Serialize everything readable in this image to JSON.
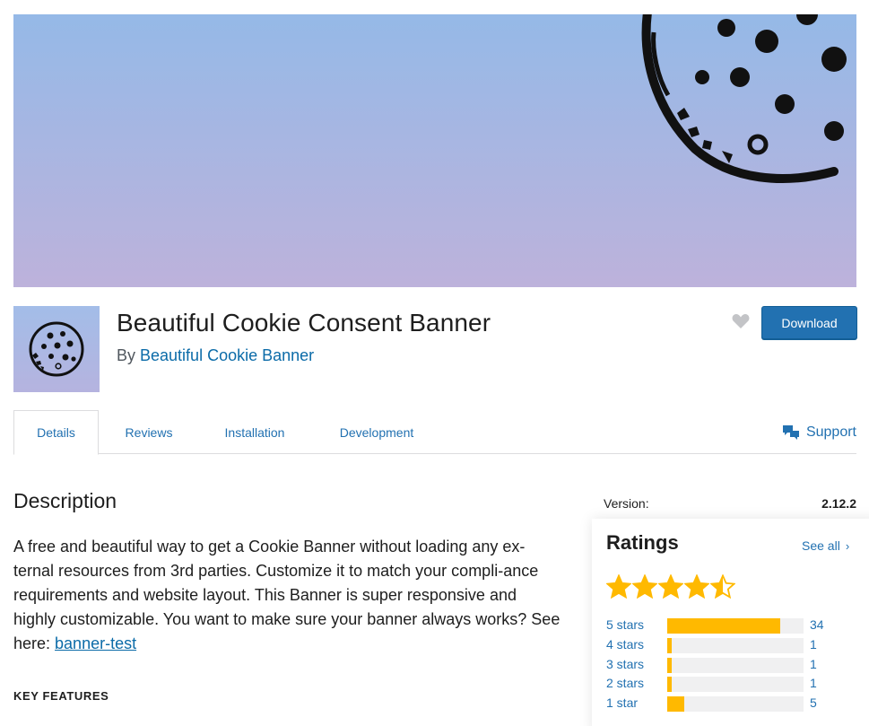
{
  "plugin": {
    "title": "Beautiful Cookie Consent Banner",
    "by_prefix": "By ",
    "author": "Beautiful Cookie Banner",
    "download_label": "Download"
  },
  "tabs": [
    {
      "label": "Details",
      "active": true
    },
    {
      "label": "Reviews",
      "active": false
    },
    {
      "label": "Installation",
      "active": false
    },
    {
      "label": "Development",
      "active": false
    }
  ],
  "support": {
    "label": "Support"
  },
  "description": {
    "heading": "Description",
    "text": "A free and beautiful way to get a Cookie Banner without loading any ex-ternal resources from 3rd parties. Customize it to match your compli-ance requirements and website layout. This Banner is super responsive and highly customizable. You want to make sure your banner always works? See here: ",
    "link_text": "banner-test",
    "key_features": "KEY FEATURES"
  },
  "meta": {
    "version_label": "Version:",
    "version_value": "2.12.2"
  },
  "ratings": {
    "heading": "Ratings",
    "see_all": "See all",
    "average": 4.5,
    "rows": [
      {
        "label": "5 stars",
        "count": "34",
        "fraction": 0.829
      },
      {
        "label": "4 stars",
        "count": "1",
        "fraction": 0.024
      },
      {
        "label": "3 stars",
        "count": "1",
        "fraction": 0.024
      },
      {
        "label": "2 stars",
        "count": "1",
        "fraction": 0.024
      },
      {
        "label": "1 star",
        "count": "5",
        "fraction": 0.122
      }
    ]
  },
  "colors": {
    "accent": "#2271b1",
    "star": "#ffb900",
    "banner_top": "#95b9e7",
    "banner_bottom": "#bdb2db"
  }
}
